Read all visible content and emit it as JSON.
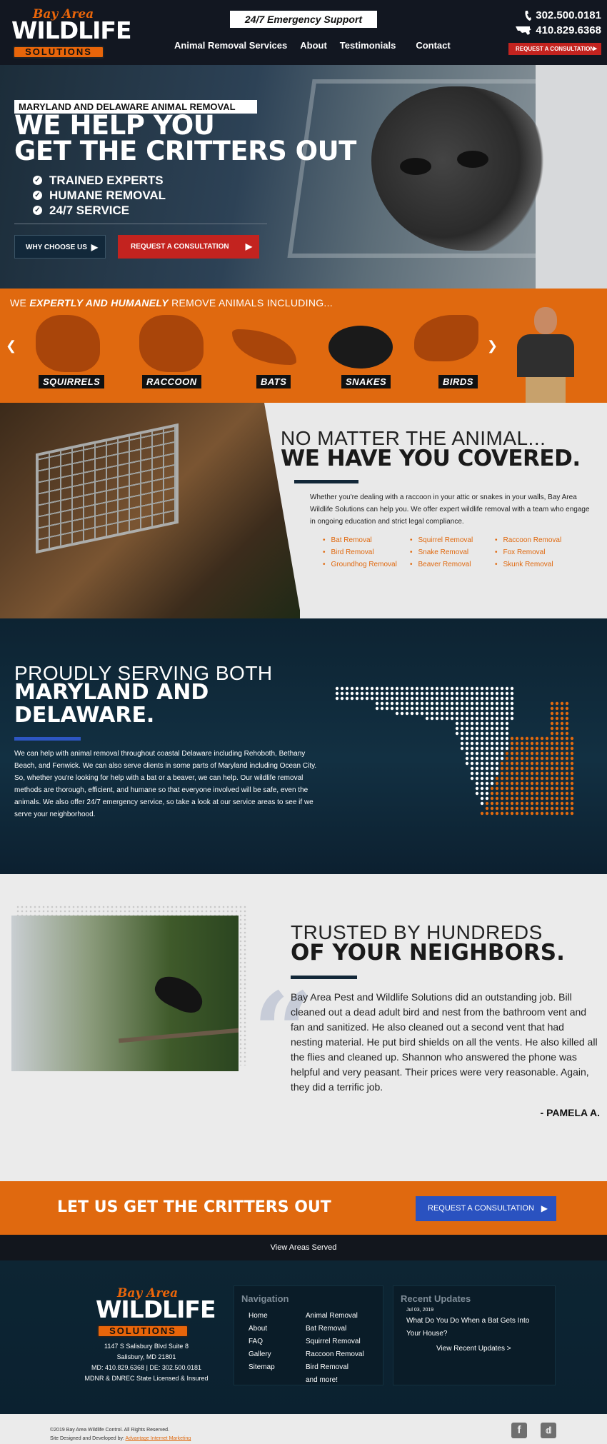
{
  "header": {
    "logo_top": "Bay Area",
    "logo_mid": "WILDLIFE",
    "logo_bottom": "SOLUTIONS",
    "emergency": "24/7 Emergency Support",
    "nav": [
      "Animal Removal Services",
      "About",
      "Testimonials",
      "Contact"
    ],
    "phone1": "302.500.0181",
    "phone2": "410.829.6368",
    "request_button": "REQUEST A CONSULTATION"
  },
  "hero": {
    "tag": "MARYLAND AND DELAWARE ANIMAL REMOVAL",
    "title_line1": "WE HELP YOU",
    "title_line2": "GET THE CRITTERS OUT",
    "bullets": [
      "TRAINED EXPERTS",
      "HUMANE REMOVAL",
      "24/7 SERVICE"
    ],
    "btn_why": "WHY CHOOSE US",
    "btn_request": "REQUEST A CONSULTATION"
  },
  "animals": {
    "title_pre": "WE ",
    "title_em": "EXPERTLY AND HUMANELY",
    "title_post": " REMOVE ANIMALS INCLUDING...",
    "items": [
      "SQUIRRELS",
      "RACCOON",
      "BATS",
      "SNAKES",
      "BIRDS"
    ]
  },
  "covered": {
    "heading_light": "NO MATTER THE ANIMAL...",
    "heading_bold": "WE HAVE YOU COVERED.",
    "paragraph": "Whether you're dealing with a raccoon in your attic or snakes in your walls, Bay Area Wildlife Solutions can help you. We offer expert wildlife removal with a team who engage in ongoing education and strict legal compliance.",
    "col1": [
      "Bat Removal",
      "Bird Removal",
      "Groundhog Removal"
    ],
    "col2": [
      "Squirrel Removal",
      "Snake Removal",
      "Beaver Removal"
    ],
    "col3": [
      "Raccoon Removal",
      "Fox Removal",
      "Skunk Removal"
    ]
  },
  "serving": {
    "heading_light": "PROUDLY SERVING BOTH",
    "heading_bold_1": "MARYLAND AND",
    "heading_bold_2": "DELAWARE.",
    "paragraph": "We can help with animal removal throughout coastal Delaware including Rehoboth, Bethany Beach, and Fenwick. We can also serve clients in some parts of Maryland including Ocean City. So, whether you're looking for help with a bat or a beaver, we can help. Our wildlife removal methods are thorough, efficient, and humane so that everyone involved will be safe, even the animals. We also offer 24/7 emergency service, so take a look at our service areas to see if we serve your neighborhood."
  },
  "testimonial": {
    "heading_light": "TRUSTED BY HUNDREDS",
    "heading_bold": "OF YOUR NEIGHBORS.",
    "quote": "Bay Area Pest and Wildlife Solutions did an outstanding job. Bill cleaned out a dead adult bird and nest from the bathroom vent and fan and sanitized. He also cleaned out a second vent that had nesting material. He put bird shields on all the vents. He also killed all the flies and cleaned up. Shannon who answered the phone was helpful and very peasant. Their prices were very reasonable. Again, they did a terrific job.",
    "author": "- PAMELA A."
  },
  "cta": {
    "text": "LET US GET THE CRITTERS OUT",
    "button": "REQUEST A CONSULTATION",
    "areas": "View Areas Served"
  },
  "footer": {
    "address_line1": "1147 S Salisbury Blvd Suite 8",
    "address_line2": "Salisbury, MD 21801",
    "phones": "MD: 410.829.6368 | DE: 302.500.0181",
    "license": "MDNR & DNREC State Licensed & Insured",
    "nav_title": "Navigation",
    "nav_col1": [
      "Home",
      "About",
      "FAQ",
      "Gallery",
      "Sitemap"
    ],
    "nav_col2": [
      "Animal Removal",
      "Bat Removal",
      "Squirrel Removal",
      "Raccoon Removal",
      "Bird Removal",
      "and more!"
    ],
    "updates_title": "Recent Updates",
    "update_date": "Jul 03, 2019",
    "update_title": "What Do You Do When a Bat Gets Into Your House?",
    "updates_link": "View Recent Updates >",
    "copyright": "©2019 Bay Area Wildlife Control. All Rights Reserved.",
    "developed_by_pre": "Site Designed and Developed by: ",
    "developed_by_link": "Advantage Internet Marketing",
    "social": [
      "facebook-icon",
      "twitter-icon"
    ]
  },
  "colors": {
    "orange": "#e0690f",
    "navy": "#122738",
    "red": "#c3231f",
    "blue": "#2a52c0"
  }
}
